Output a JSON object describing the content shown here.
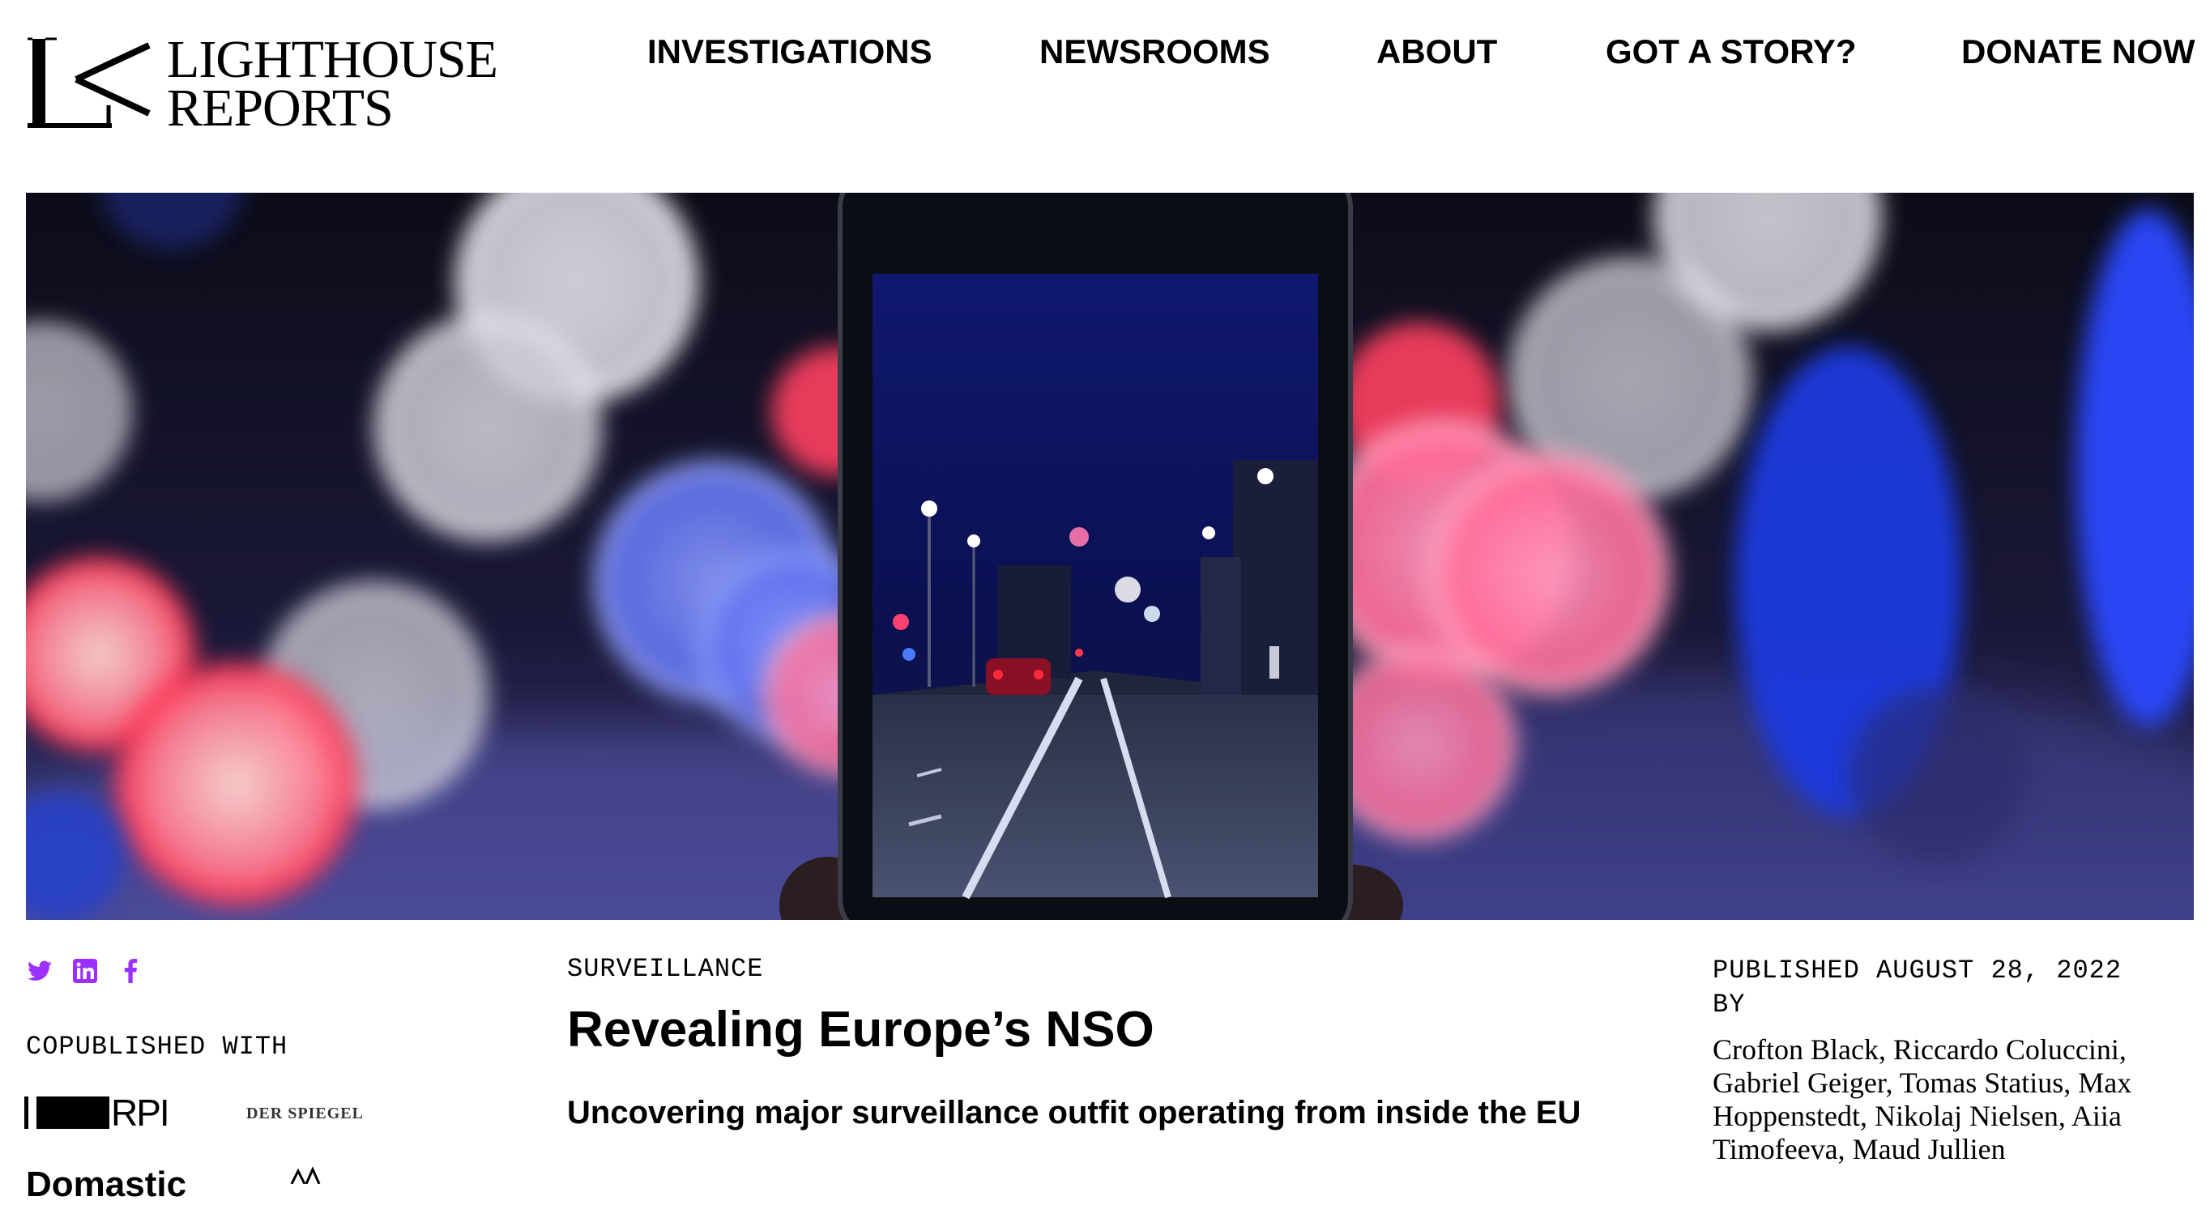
{
  "site": {
    "logo_line1": "LIGHTHOUSE",
    "logo_line2": "REPORTS"
  },
  "nav": {
    "items": [
      {
        "label": "INVESTIGATIONS"
      },
      {
        "label": "NEWSROOMS"
      },
      {
        "label": "ABOUT"
      },
      {
        "label": "GOT A STORY?"
      },
      {
        "label": "DONATE NOW"
      }
    ]
  },
  "hero": {
    "image_alt": "Hand holding smartphone showing night street scene with colorful bokeh lights"
  },
  "share": {
    "accent_color": "#9b30ff",
    "icons": [
      "twitter-icon",
      "linkedin-icon",
      "facebook-icon"
    ]
  },
  "copublished": {
    "label": "COPUBLISHED WITH",
    "partners": [
      {
        "name": "IRPI",
        "logo_text": "RPI"
      },
      {
        "name": "Der Spiegel",
        "logo_text": "DER SPIEGEL"
      }
    ],
    "more_cut_text": "Domastic"
  },
  "article": {
    "category": "SURVEILLANCE",
    "title": "Revealing Europe’s NSO",
    "subtitle": "Uncovering major surveillance outfit operating from inside the EU",
    "published": "PUBLISHED AUGUST 28, 2022",
    "by_label": "BY",
    "authors": "Crofton Black, Riccardo Coluccini, Gabriel Geiger, Tomas Statius, Max Hoppenstedt, Nikolaj Nielsen, Aiia Timofeeva, Maud Jullien"
  }
}
